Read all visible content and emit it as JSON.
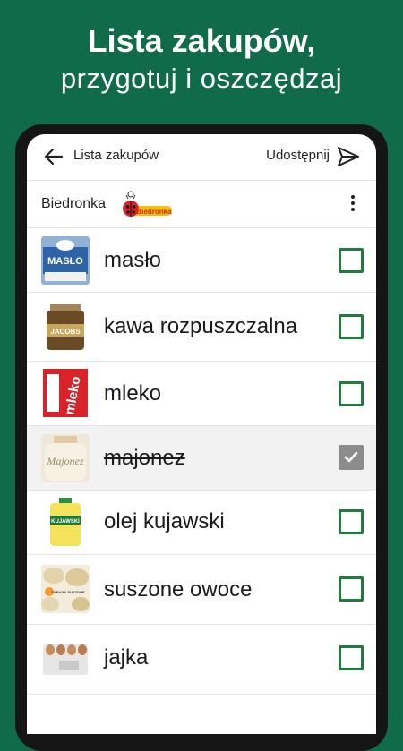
{
  "promo": {
    "title": "Lista zakupów,",
    "subtitle": "przygotuj i oszczędzaj"
  },
  "appbar": {
    "title": "Lista zakupów",
    "share_label": "Udostępnij"
  },
  "store": {
    "name": "Biedronka",
    "logo_text": "Biedronka"
  },
  "items": [
    {
      "label": "masło",
      "checked": false,
      "thumb_text": "MASŁO"
    },
    {
      "label": "kawa rozpuszczalna",
      "checked": false,
      "thumb_text": "JACOBS"
    },
    {
      "label": "mleko",
      "checked": false,
      "thumb_text": "mleko"
    },
    {
      "label": "majonez",
      "checked": true,
      "thumb_text": "Majonez"
    },
    {
      "label": "olej kujawski",
      "checked": false,
      "thumb_text": "KUJAWSKI"
    },
    {
      "label": "suszone owoce",
      "checked": false,
      "thumb_text": "ZABAGA SUSZONE"
    },
    {
      "label": "jajka",
      "checked": false,
      "thumb_text": ""
    }
  ],
  "colors": {
    "background": "#0f6b4a",
    "checkbox": "#1f7c3c",
    "checked_row": "#f2f2f2"
  }
}
